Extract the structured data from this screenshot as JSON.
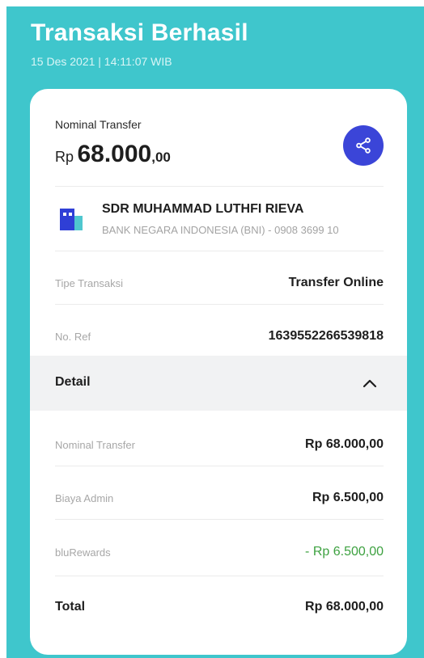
{
  "header": {
    "title": "Transaksi Berhasil",
    "datetime": "15 Des 2021  |  14:11:07 WIB"
  },
  "summary": {
    "label": "Nominal Transfer",
    "currency": "Rp",
    "amount_main": "68.000",
    "amount_decimal": ",00",
    "share_icon": "share-icon"
  },
  "recipient": {
    "icon": "bank-building-icon",
    "name": "SDR MUHAMMAD LUTHFI RIEVA",
    "bank": "BANK NEGARA INDONESIA (BNI) - 0908 3699 10"
  },
  "info": {
    "type_label": "Tipe Transaksi",
    "type_value": "Transfer Online",
    "ref_label": "No. Ref",
    "ref_value": "1639552266539818"
  },
  "detail": {
    "label": "Detail",
    "expanded": true,
    "chevron_icon": "chevron-up-icon",
    "nominal_label": "Nominal Transfer",
    "nominal_value": "Rp 68.000,00",
    "admin_label": "Biaya Admin",
    "admin_value": "Rp 6.500,00",
    "rewards_label": "bluRewards",
    "rewards_value": "- Rp 6.500,00",
    "total_label": "Total",
    "total_value": "Rp 68.000,00"
  },
  "colors": {
    "background": "#3fc6cc",
    "accent_button": "#3b45d8",
    "rewards_green": "#3da140"
  }
}
